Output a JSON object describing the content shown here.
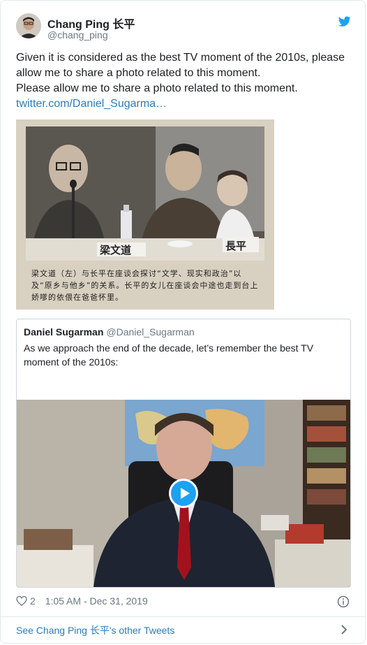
{
  "author": {
    "name": "Chang Ping 长平",
    "handle": "@chang_ping"
  },
  "tweet": {
    "line1": "Given it is considered as the best TV moment of the 2010s, please allow me to share a photo related to this moment.",
    "line2": "Please allow me to share a photo related to this moment.",
    "link": "twitter.com/Daniel_Sugarma…"
  },
  "photo": {
    "caption": "梁文道（左）与长平在座谈会探讨“文学、现实和政治”以及“原乡与他乡”的关系。长平的女儿在座谈会中途也走到台上娇嗲的依偎在爸爸怀里。",
    "nameplate_left": "梁文道",
    "nameplate_right": "長平"
  },
  "quoted": {
    "name": "Daniel Sugarman",
    "handle": "@Daniel_Sugarman",
    "text": "As we approach the end of the decade, let’s remember the best TV moment of the 2010s:"
  },
  "footer": {
    "likes": "2",
    "timestamp": "1:05 AM - Dec 31, 2019"
  },
  "more_tweets": "See Chang Ping 长平's other Tweets",
  "colors": {
    "accent": "#1da1f2",
    "link": "#2b7bb9"
  },
  "icons": {
    "brand": "twitter-bird-icon",
    "like": "heart-icon",
    "info": "info-icon",
    "play": "play-icon",
    "next": "chevron-right-icon"
  }
}
